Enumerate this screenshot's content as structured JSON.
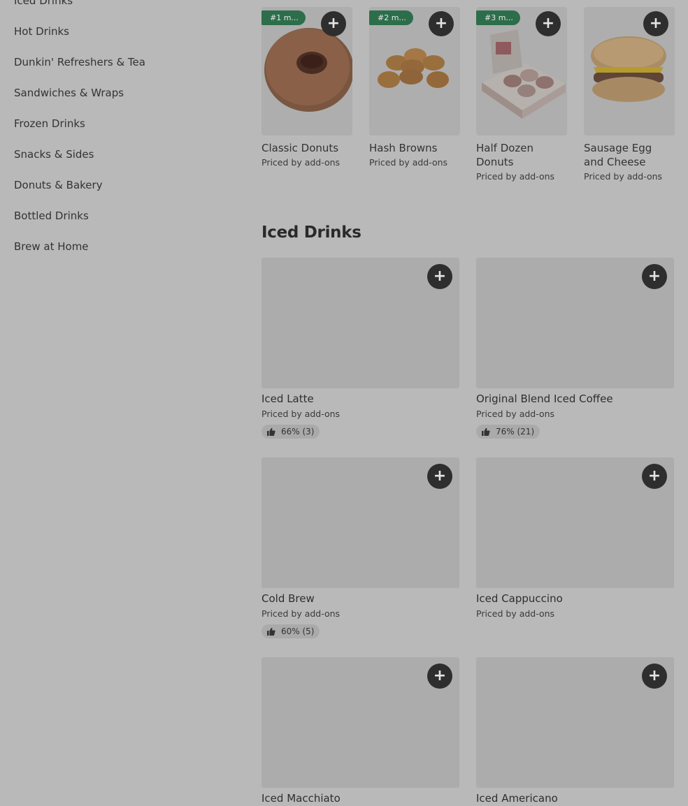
{
  "sidebar": {
    "items": [
      {
        "label": "Iced Drinks"
      },
      {
        "label": "Hot Drinks"
      },
      {
        "label": "Dunkin' Refreshers & Tea"
      },
      {
        "label": "Sandwiches & Wraps"
      },
      {
        "label": "Frozen Drinks"
      },
      {
        "label": "Snacks & Sides"
      },
      {
        "label": "Donuts & Bakery"
      },
      {
        "label": "Bottled Drinks"
      },
      {
        "label": "Brew at Home"
      }
    ]
  },
  "popular": [
    {
      "badge": "#1 m...",
      "name": "Classic Donuts",
      "price": "Priced by add-ons",
      "icon": "donut-image"
    },
    {
      "badge": "#2 m...",
      "name": "Hash Browns",
      "price": "Priced by add-ons",
      "icon": "hash-browns-image"
    },
    {
      "badge": "#3 m...",
      "name": "Half Dozen Donuts",
      "price": "Priced by add-ons",
      "icon": "donut-box-image"
    },
    {
      "badge": "",
      "name": "Sausage Egg and Cheese",
      "price": "Priced by add-ons",
      "icon": "sandwich-image"
    }
  ],
  "section": {
    "title": "Iced Drinks"
  },
  "items": [
    {
      "name": "Iced Latte",
      "price": "Priced by add-ons",
      "rating": "66% (3)"
    },
    {
      "name": "Original Blend Iced Coffee",
      "price": "Priced by add-ons",
      "rating": "76% (21)"
    },
    {
      "name": "Cold Brew",
      "price": "Priced by add-ons",
      "rating": "60% (5)"
    },
    {
      "name": "Iced Cappuccino",
      "price": "Priced by add-ons",
      "rating": ""
    },
    {
      "name": "Iced Macchiato",
      "price": "",
      "rating": ""
    },
    {
      "name": "Iced Americano",
      "price": "",
      "rating": ""
    }
  ],
  "add_symbol": "+",
  "colors": {
    "badge": "#2c6e4a",
    "add_button": "#2e2e2e",
    "overlay": "#b9b9b9"
  }
}
